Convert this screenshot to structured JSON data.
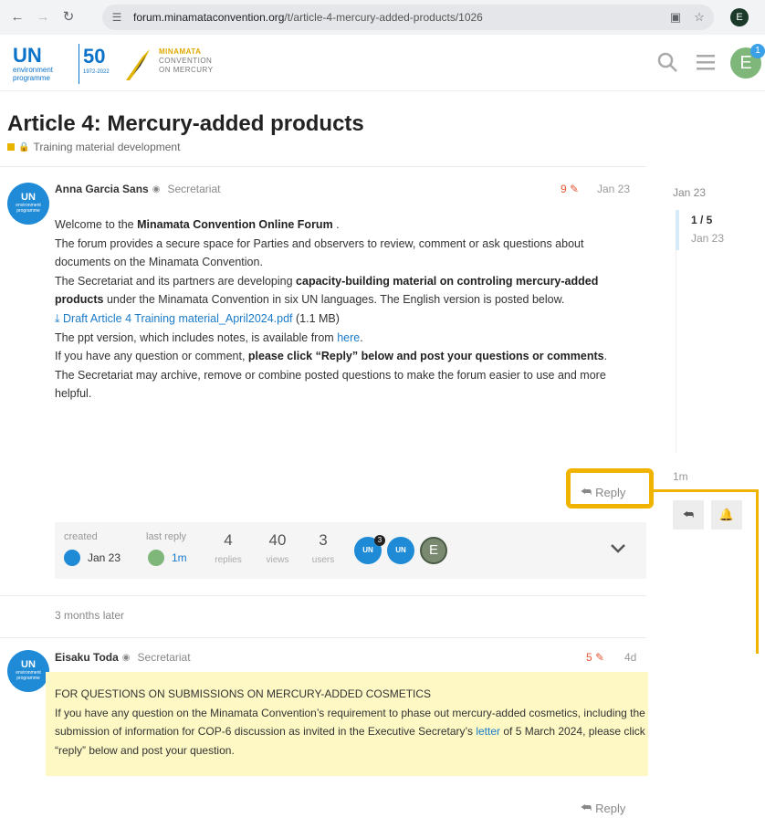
{
  "browser": {
    "url_domain": "forum.minamataconvention.org",
    "url_path": "/t/article-4-mercury-added-products/1026",
    "profile_initial": "E"
  },
  "header": {
    "un_logo": "UN",
    "un_logo_sub": "environment programme",
    "anniversary": "50",
    "anniversary_years": "1972-2022",
    "minamata_line1": "MINAMATA",
    "minamata_line2": "CONVENTION",
    "minamata_line3": "ON MERCURY",
    "user_initial": "E",
    "notification_count": "1"
  },
  "topic": {
    "title": "Article 4: Mercury-added products",
    "category": "Training material development"
  },
  "post1": {
    "author": "Anna Garcia Sans",
    "role": "Secretariat",
    "edits": "9",
    "date": "Jan 23",
    "avatar_text": "UN",
    "avatar_sub": "environment programme",
    "welcome_prefix": "Welcome to the ",
    "welcome_bold": "Minamata Convention Online Forum",
    "welcome_suffix": " .",
    "line2": "The forum provides a secure space for Parties and observers to review, comment or ask questions about documents on the Minamata Convention.",
    "line3_prefix": "The Secretariat and its partners are developing ",
    "line3_bold": "capacity-building material on controling mercury-added products",
    "line3_suffix": " under the Minamata Convention in six UN languages. The English version is posted below.",
    "attachment_name": "Draft Article 4 Training material_April2024.pdf",
    "attachment_size": " (1.1 MB)",
    "ppt_prefix": "The ppt version, which includes notes, is available from ",
    "ppt_link": "here",
    "ppt_suffix": ".",
    "question_prefix": "If you have any question or comment, ",
    "question_bold": "please click “Reply” below and post your questions or comments",
    "question_suffix": ".",
    "archive_text": "The Secretariat may archive, remove or combine posted questions to make the forum easier to use and more helpful.",
    "reply_label": "Reply"
  },
  "topic_map": {
    "created_label": "created",
    "created_value": "Jan 23",
    "last_reply_label": "last reply",
    "last_reply_value": "1m",
    "replies_count": "4",
    "replies_label": "replies",
    "views_count": "40",
    "views_label": "views",
    "users_count": "3",
    "users_label": "users",
    "top_user_badge": "3",
    "user3_initial": "E"
  },
  "gap_label": "3 months later",
  "post2": {
    "author": "Eisaku Toda",
    "role": "Secretariat",
    "edits": "5",
    "date": "4d",
    "avatar_text": "UN",
    "avatar_sub": "environment programme",
    "heading": "FOR QUESTIONS ON SUBMISSIONS ON MERCURY-ADDED COSMETICS",
    "body_prefix": "If you have any question on the Minamata Convention’s requirement to phase out mercury-added cosmetics, including the submission of information for COP-6 discussion as invited in the Executive Secretary’s ",
    "body_link": "letter",
    "body_suffix": " of 5 March 2024, please click “reply” below and post your question.",
    "reply_label": "Reply"
  },
  "timeline": {
    "top_date": "Jan 23",
    "position": "1 / 5",
    "position_date": "Jan 23",
    "bottom_label": "1m"
  }
}
